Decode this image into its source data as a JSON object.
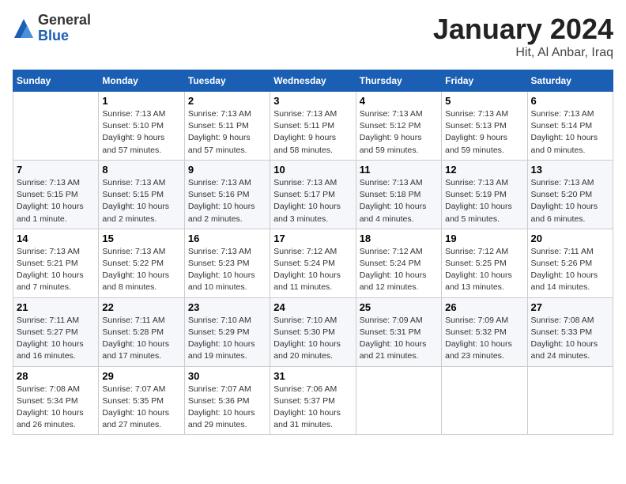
{
  "header": {
    "logo": {
      "general": "General",
      "blue": "Blue"
    },
    "title": "January 2024",
    "subtitle": "Hit, Al Anbar, Iraq"
  },
  "calendar": {
    "columns": [
      "Sunday",
      "Monday",
      "Tuesday",
      "Wednesday",
      "Thursday",
      "Friday",
      "Saturday"
    ],
    "weeks": [
      [
        {
          "day": "",
          "info": ""
        },
        {
          "day": "1",
          "info": "Sunrise: 7:13 AM\nSunset: 5:10 PM\nDaylight: 9 hours\nand 57 minutes."
        },
        {
          "day": "2",
          "info": "Sunrise: 7:13 AM\nSunset: 5:11 PM\nDaylight: 9 hours\nand 57 minutes."
        },
        {
          "day": "3",
          "info": "Sunrise: 7:13 AM\nSunset: 5:11 PM\nDaylight: 9 hours\nand 58 minutes."
        },
        {
          "day": "4",
          "info": "Sunrise: 7:13 AM\nSunset: 5:12 PM\nDaylight: 9 hours\nand 59 minutes."
        },
        {
          "day": "5",
          "info": "Sunrise: 7:13 AM\nSunset: 5:13 PM\nDaylight: 9 hours\nand 59 minutes."
        },
        {
          "day": "6",
          "info": "Sunrise: 7:13 AM\nSunset: 5:14 PM\nDaylight: 10 hours\nand 0 minutes."
        }
      ],
      [
        {
          "day": "7",
          "info": "Sunrise: 7:13 AM\nSunset: 5:15 PM\nDaylight: 10 hours\nand 1 minute."
        },
        {
          "day": "8",
          "info": "Sunrise: 7:13 AM\nSunset: 5:15 PM\nDaylight: 10 hours\nand 2 minutes."
        },
        {
          "day": "9",
          "info": "Sunrise: 7:13 AM\nSunset: 5:16 PM\nDaylight: 10 hours\nand 2 minutes."
        },
        {
          "day": "10",
          "info": "Sunrise: 7:13 AM\nSunset: 5:17 PM\nDaylight: 10 hours\nand 3 minutes."
        },
        {
          "day": "11",
          "info": "Sunrise: 7:13 AM\nSunset: 5:18 PM\nDaylight: 10 hours\nand 4 minutes."
        },
        {
          "day": "12",
          "info": "Sunrise: 7:13 AM\nSunset: 5:19 PM\nDaylight: 10 hours\nand 5 minutes."
        },
        {
          "day": "13",
          "info": "Sunrise: 7:13 AM\nSunset: 5:20 PM\nDaylight: 10 hours\nand 6 minutes."
        }
      ],
      [
        {
          "day": "14",
          "info": "Sunrise: 7:13 AM\nSunset: 5:21 PM\nDaylight: 10 hours\nand 7 minutes."
        },
        {
          "day": "15",
          "info": "Sunrise: 7:13 AM\nSunset: 5:22 PM\nDaylight: 10 hours\nand 8 minutes."
        },
        {
          "day": "16",
          "info": "Sunrise: 7:13 AM\nSunset: 5:23 PM\nDaylight: 10 hours\nand 10 minutes."
        },
        {
          "day": "17",
          "info": "Sunrise: 7:12 AM\nSunset: 5:24 PM\nDaylight: 10 hours\nand 11 minutes."
        },
        {
          "day": "18",
          "info": "Sunrise: 7:12 AM\nSunset: 5:24 PM\nDaylight: 10 hours\nand 12 minutes."
        },
        {
          "day": "19",
          "info": "Sunrise: 7:12 AM\nSunset: 5:25 PM\nDaylight: 10 hours\nand 13 minutes."
        },
        {
          "day": "20",
          "info": "Sunrise: 7:11 AM\nSunset: 5:26 PM\nDaylight: 10 hours\nand 14 minutes."
        }
      ],
      [
        {
          "day": "21",
          "info": "Sunrise: 7:11 AM\nSunset: 5:27 PM\nDaylight: 10 hours\nand 16 minutes."
        },
        {
          "day": "22",
          "info": "Sunrise: 7:11 AM\nSunset: 5:28 PM\nDaylight: 10 hours\nand 17 minutes."
        },
        {
          "day": "23",
          "info": "Sunrise: 7:10 AM\nSunset: 5:29 PM\nDaylight: 10 hours\nand 19 minutes."
        },
        {
          "day": "24",
          "info": "Sunrise: 7:10 AM\nSunset: 5:30 PM\nDaylight: 10 hours\nand 20 minutes."
        },
        {
          "day": "25",
          "info": "Sunrise: 7:09 AM\nSunset: 5:31 PM\nDaylight: 10 hours\nand 21 minutes."
        },
        {
          "day": "26",
          "info": "Sunrise: 7:09 AM\nSunset: 5:32 PM\nDaylight: 10 hours\nand 23 minutes."
        },
        {
          "day": "27",
          "info": "Sunrise: 7:08 AM\nSunset: 5:33 PM\nDaylight: 10 hours\nand 24 minutes."
        }
      ],
      [
        {
          "day": "28",
          "info": "Sunrise: 7:08 AM\nSunset: 5:34 PM\nDaylight: 10 hours\nand 26 minutes."
        },
        {
          "day": "29",
          "info": "Sunrise: 7:07 AM\nSunset: 5:35 PM\nDaylight: 10 hours\nand 27 minutes."
        },
        {
          "day": "30",
          "info": "Sunrise: 7:07 AM\nSunset: 5:36 PM\nDaylight: 10 hours\nand 29 minutes."
        },
        {
          "day": "31",
          "info": "Sunrise: 7:06 AM\nSunset: 5:37 PM\nDaylight: 10 hours\nand 31 minutes."
        },
        {
          "day": "",
          "info": ""
        },
        {
          "day": "",
          "info": ""
        },
        {
          "day": "",
          "info": ""
        }
      ]
    ]
  }
}
